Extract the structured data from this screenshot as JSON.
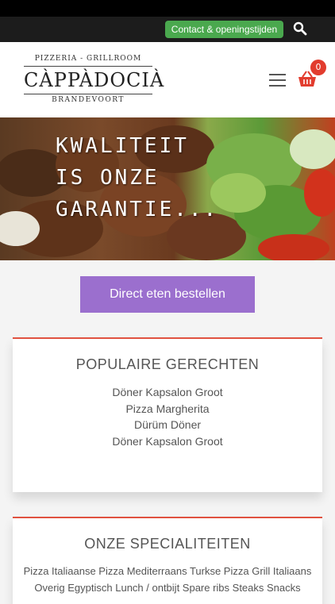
{
  "topbar": {
    "contact_label": "Contact & openingstijden"
  },
  "logo": {
    "top": "PIZZERIA - GRILLROOM",
    "main": "CÀPPÀDOCIÀ",
    "bottom": "BRANDEVOORT"
  },
  "cart": {
    "count": "0"
  },
  "hero": {
    "line1": "KWALITEIT",
    "line2": "IS ONZE",
    "line3": "GARANTIE..."
  },
  "order_button": "Direct eten bestellen",
  "popular": {
    "title": "POPULAIRE GERECHTEN",
    "items": [
      "Döner Kapsalon Groot",
      "Pizza Margherita",
      "Dürüm Döner",
      "Döner Kapsalon Groot"
    ]
  },
  "specialties": {
    "title": "ONZE SPECIALITEITEN",
    "line1": "Pizza Italiaanse Pizza Mediterraans Turkse Pizza Grill Italiaans",
    "line2": "Overig Egyptisch Lunch / ontbijt Spare ribs Steaks Snacks"
  },
  "colors": {
    "contact_button": "#4aa84e",
    "order_button": "#9b6fce",
    "card_accent": "#e05240",
    "cart_icon": "#e23c2e"
  }
}
